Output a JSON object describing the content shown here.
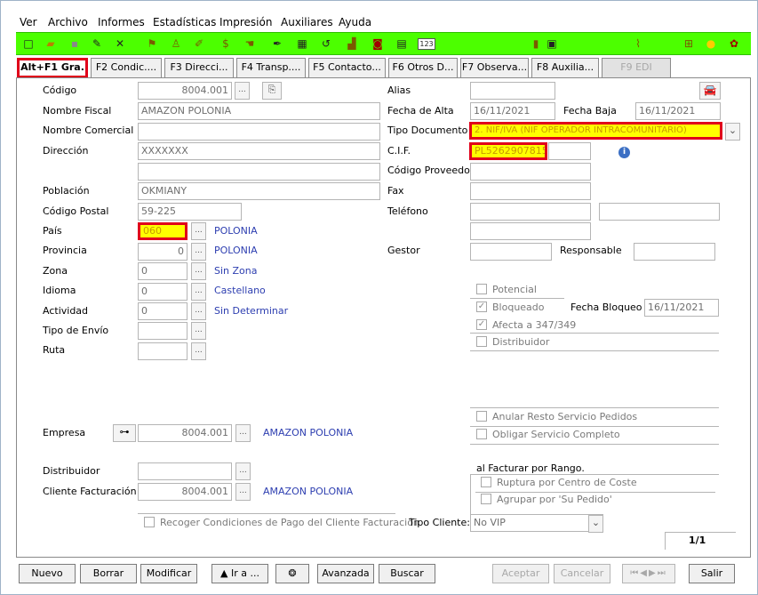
{
  "menu": {
    "items": [
      "Ver",
      "Archivo",
      "Informes",
      "Estadísticas",
      "Impresión",
      "Auxiliares",
      "Ayuda"
    ]
  },
  "toolbar": {
    "left_icons": [
      "new-file-icon",
      "open-folder-icon",
      "save-icon",
      "edit-icon",
      "delete-icon",
      "filter-icon",
      "people-icon",
      "pencil-icon",
      "money-icon",
      "hand-icon",
      "pen-icon",
      "table-icon",
      "refresh-icon",
      "chart-icon",
      "briefcase-icon",
      "calculator-icon",
      "numbers-icon"
    ],
    "right_icons": [
      "bottle-icon",
      "document-icon",
      "paperclip-icon",
      "tree-icon",
      "bulb-icon",
      "tools-icon"
    ],
    "number_icon_label": "123",
    "accent": "#4cff00"
  },
  "tabs": [
    {
      "label": "Alt+F1 Gra.",
      "active": true,
      "disabled": false
    },
    {
      "label": "F2 Condic....",
      "active": false,
      "disabled": false
    },
    {
      "label": "F3 Direcci...",
      "active": false,
      "disabled": false
    },
    {
      "label": "F4 Transp....",
      "active": false,
      "disabled": false
    },
    {
      "label": "F5 Contacto...",
      "active": false,
      "disabled": false
    },
    {
      "label": "F6 Otros D...",
      "active": false,
      "disabled": false
    },
    {
      "label": "F7 Observa...",
      "active": false,
      "disabled": false
    },
    {
      "label": "F8 Auxilia...",
      "active": false,
      "disabled": false
    },
    {
      "label": "F9 EDI",
      "active": false,
      "disabled": true
    }
  ],
  "form": {
    "codigo": {
      "label": "Código",
      "value": "8004.001"
    },
    "nombre_fiscal": {
      "label": "Nombre Fiscal",
      "value": "AMAZON POLONIA"
    },
    "nombre_comercial": {
      "label": "Nombre Comercial",
      "value": ""
    },
    "direccion": {
      "label": "Dirección",
      "value": "XXXXXXX",
      "value2": ""
    },
    "poblacion": {
      "label": "Población",
      "value": "OKMIANY"
    },
    "codigo_postal": {
      "label": "Código Postal",
      "value": "59-225"
    },
    "pais": {
      "label": "País",
      "value": "060",
      "desc": "POLONIA"
    },
    "provincia": {
      "label": "Provincia",
      "value": "0",
      "desc": "POLONIA"
    },
    "zona": {
      "label": "Zona",
      "value": "0",
      "desc": "Sin Zona"
    },
    "idioma": {
      "label": "Idioma",
      "value": "0",
      "desc": "Castellano"
    },
    "actividad": {
      "label": "Actividad",
      "value": "0",
      "desc": "Sin Determinar"
    },
    "tipo_envio": {
      "label": "Tipo de Envío",
      "value": ""
    },
    "ruta": {
      "label": "Ruta",
      "value": ""
    },
    "alias": {
      "label": "Alias",
      "value": ""
    },
    "fecha_alta": {
      "label": "Fecha de Alta",
      "value": "16/11/2021"
    },
    "fecha_baja": {
      "label": "Fecha Baja",
      "value": "16/11/2021"
    },
    "tipo_documento": {
      "label": "Tipo Documento",
      "value": "2. NIF/IVA (NIF OPERADOR INTRACOMUNITARIO)"
    },
    "cif": {
      "label": "C.I.F.",
      "value": "PL5262907815"
    },
    "codigo_proveedor": {
      "label": "Código Proveedor",
      "value": ""
    },
    "fax": {
      "label": "Fax",
      "value": ""
    },
    "telefono": {
      "label": "Teléfono",
      "value": "",
      "value2": "",
      "value3": ""
    },
    "gestor": {
      "label": "Gestor",
      "value": ""
    },
    "responsable": {
      "label": "Responsable",
      "value": ""
    },
    "potencial": {
      "label": "Potencial",
      "checked": false
    },
    "bloqueado": {
      "label": "Bloqueado",
      "checked": true
    },
    "fecha_bloqueo": {
      "label": "Fecha Bloqueo",
      "value": "16/11/2021"
    },
    "afecta_347": {
      "label": "Afecta a 347/349",
      "checked": true
    },
    "distribuidor_chk": {
      "label": "Distribuidor",
      "checked": false
    },
    "anular_resto": {
      "label": "Anular Resto Servicio Pedidos",
      "checked": false
    },
    "obligar_servicio": {
      "label": "Obligar Servicio Completo",
      "checked": false
    },
    "empresa": {
      "label": "Empresa",
      "value": "8004.001",
      "desc": "AMAZON POLONIA"
    },
    "distribuidor": {
      "label": "Distribuidor",
      "value": ""
    },
    "cliente_facturacion": {
      "label": "Cliente Facturación",
      "value": "8004.001",
      "desc": "AMAZON POLONIA"
    },
    "al_facturar_rango": {
      "label": "al Facturar por Rango.",
      "ruptura": "Ruptura por Centro de Coste",
      "agrupar": "Agrupar por 'Su Pedido'"
    },
    "recoger_condiciones": {
      "label": "Recoger Condiciones de Pago del Cliente Facturación",
      "checked": false
    },
    "tipo_cliente": {
      "label": "Tipo Cliente:",
      "value": "No VIP"
    },
    "pager": "1/1",
    "ellipsis": "...",
    "dropdown_arrow": "⌄"
  },
  "bottom": {
    "nuevo": "Nuevo",
    "borrar": "Borrar",
    "modificar": "Modificar",
    "ira": "Ir a ...",
    "avanzada": "Avanzada",
    "buscar": "Buscar",
    "aceptar": "Aceptar",
    "cancelar": "Cancelar",
    "salir": "Salir",
    "nav_icons": [
      "first-icon",
      "prev-icon",
      "next-icon",
      "last-icon"
    ]
  },
  "colors": {
    "highlight_border": "#e0001a",
    "highlight_fill": "#ffff00",
    "link": "#2d3eb0"
  }
}
